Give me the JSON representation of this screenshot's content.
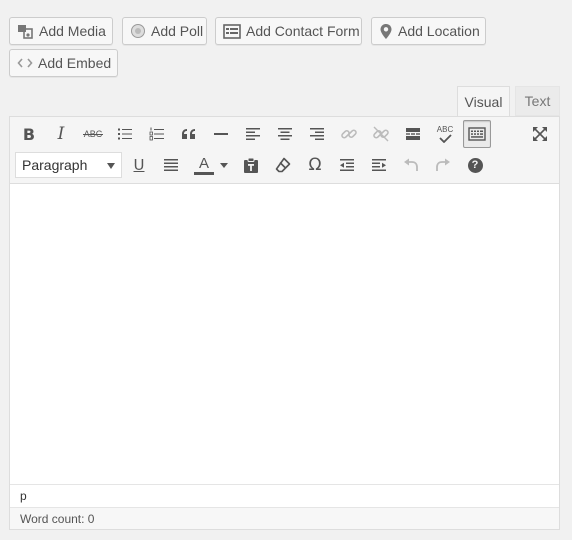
{
  "media_buttons": [
    {
      "label": "Add Media",
      "icon": "add-media-icon"
    },
    {
      "label": "Add Poll",
      "icon": "poll-icon"
    },
    {
      "label": "Add Contact Form",
      "icon": "contact-form-icon"
    },
    {
      "label": "Add Location",
      "icon": "location-pin-icon"
    },
    {
      "label": "Add Embed",
      "icon": "embed-icon"
    }
  ],
  "tabs": {
    "visual": "Visual",
    "text": "Text",
    "active": "visual"
  },
  "toolbar": {
    "row1": [
      "bold-icon",
      "italic-icon",
      "strikethrough-icon",
      "bullet-list-icon",
      "numbered-list-icon",
      "blockquote-icon",
      "horizontal-line-icon",
      "align-left-icon",
      "align-center-icon",
      "align-right-icon",
      "insert-link-icon",
      "remove-link-icon",
      "read-more-icon",
      "spellcheck-icon",
      "toolbar-toggle-icon",
      "fullscreen-icon"
    ],
    "row2": [
      "underline-icon",
      "justify-icon",
      "text-color-icon",
      "paste-as-text-icon",
      "clear-formatting-icon",
      "special-character-icon",
      "outdent-icon",
      "indent-icon",
      "undo-icon",
      "redo-icon",
      "help-icon"
    ],
    "bold_glyph": "B",
    "italic_glyph": "I",
    "strike_glyph": "ABC",
    "spell_glyph": "ABC",
    "underline_glyph": "U",
    "textcolor_glyph": "A",
    "omega_glyph": "Ω",
    "help_glyph": "?"
  },
  "format_select": {
    "value": "Paragraph"
  },
  "editor": {
    "content": "",
    "path": "p",
    "word_count": "Word count: 0"
  },
  "colors": {
    "background": "#f1f1f1",
    "toolbar": "#f5f5f5",
    "border": "#dddddd",
    "icon": "#555555",
    "disabled_icon": "#bbbbbb"
  }
}
